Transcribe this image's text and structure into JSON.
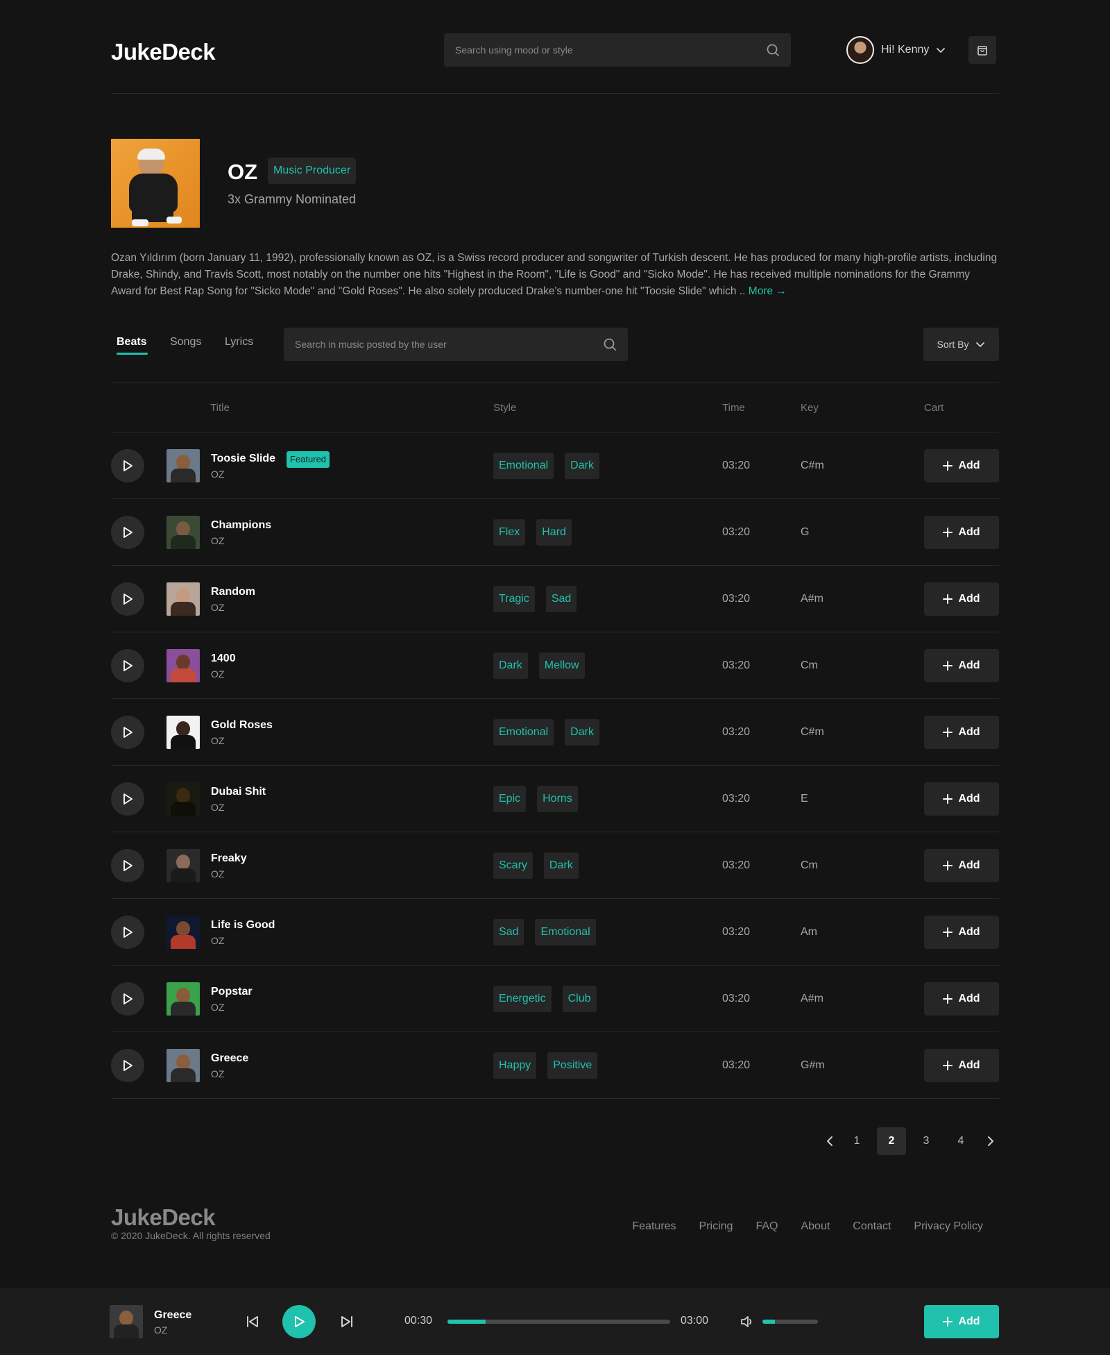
{
  "app": {
    "logo": "JukeDeck"
  },
  "header": {
    "search_placeholder": "Search using mood or style",
    "user_greeting": "Hi! Kenny"
  },
  "profile": {
    "name": "OZ",
    "role": "Music Producer",
    "subtitle": "3x Grammy Nominated",
    "bio": "Ozan Yıldırım (born January 11, 1992), professionally known as OZ, is a Swiss record producer and songwriter of Turkish descent. He has produced for many high-profile artists, including Drake, Shindy, and Travis Scott, most notably on the number one hits \"Highest in the Room\", \"Life is Good\" and \"Sicko Mode\". He has received multiple nominations for the Grammy Award for Best Rap Song for \"Sicko Mode\" and \"Gold Roses\". He also solely produced Drake's number-one hit \"Toosie Slide\" which .. ",
    "more_label": "More →"
  },
  "tabs": {
    "items": [
      {
        "label": "Beats",
        "active": true
      },
      {
        "label": "Songs",
        "active": false
      },
      {
        "label": "Lyrics",
        "active": false
      }
    ],
    "search_placeholder": "Search in music posted by the user",
    "sort_label": "Sort By"
  },
  "table": {
    "headers": {
      "title": "Title",
      "style": "Style",
      "time": "Time",
      "key": "Key",
      "cart": "Cart"
    },
    "add_label": "Add",
    "featured_label": "Featured",
    "rows": [
      {
        "title": "Toosie Slide",
        "artist": "OZ",
        "featured": true,
        "tags": [
          "Emotional",
          "Dark"
        ],
        "time": "03:20",
        "key": "C#m"
      },
      {
        "title": "Champions",
        "artist": "OZ",
        "featured": false,
        "tags": [
          "Flex",
          "Hard"
        ],
        "time": "03:20",
        "key": "G"
      },
      {
        "title": "Random",
        "artist": "OZ",
        "featured": false,
        "tags": [
          "Tragic",
          "Sad"
        ],
        "time": "03:20",
        "key": "A#m"
      },
      {
        "title": "1400",
        "artist": "OZ",
        "featured": false,
        "tags": [
          "Dark",
          "Mellow"
        ],
        "time": "03:20",
        "key": "Cm"
      },
      {
        "title": "Gold Roses",
        "artist": "OZ",
        "featured": false,
        "tags": [
          "Emotional",
          "Dark"
        ],
        "time": "03:20",
        "key": "C#m"
      },
      {
        "title": "Dubai Shit",
        "artist": "OZ",
        "featured": false,
        "tags": [
          "Epic",
          "Horns"
        ],
        "time": "03:20",
        "key": "E"
      },
      {
        "title": "Freaky",
        "artist": "OZ",
        "featured": false,
        "tags": [
          "Scary",
          "Dark"
        ],
        "time": "03:20",
        "key": "Cm"
      },
      {
        "title": "Life is Good",
        "artist": "OZ",
        "featured": false,
        "tags": [
          "Sad",
          "Emotional"
        ],
        "time": "03:20",
        "key": "Am"
      },
      {
        "title": "Popstar",
        "artist": "OZ",
        "featured": false,
        "tags": [
          "Energetic",
          "Club"
        ],
        "time": "03:20",
        "key": "A#m"
      },
      {
        "title": "Greece",
        "artist": "OZ",
        "featured": false,
        "tags": [
          "Happy",
          "Positive"
        ],
        "time": "03:20",
        "key": "G#m"
      }
    ]
  },
  "pagination": {
    "pages": [
      "1",
      "2",
      "3",
      "4"
    ],
    "current": "2"
  },
  "footer": {
    "logo": "JukeDeck",
    "copyright": "© 2020 JukeDeck. All rights reserved",
    "links": [
      "Features",
      "Pricing",
      "FAQ",
      "About",
      "Contact",
      "Privacy Policy"
    ]
  },
  "player": {
    "title": "Greece",
    "artist": "OZ",
    "elapsed": "00:30",
    "duration": "03:00",
    "progress": 0.17,
    "volume": 0.22,
    "add_label": "Add"
  },
  "colors": {
    "accent": "#20c1ad",
    "background": "#141414",
    "surface": "#262626"
  }
}
